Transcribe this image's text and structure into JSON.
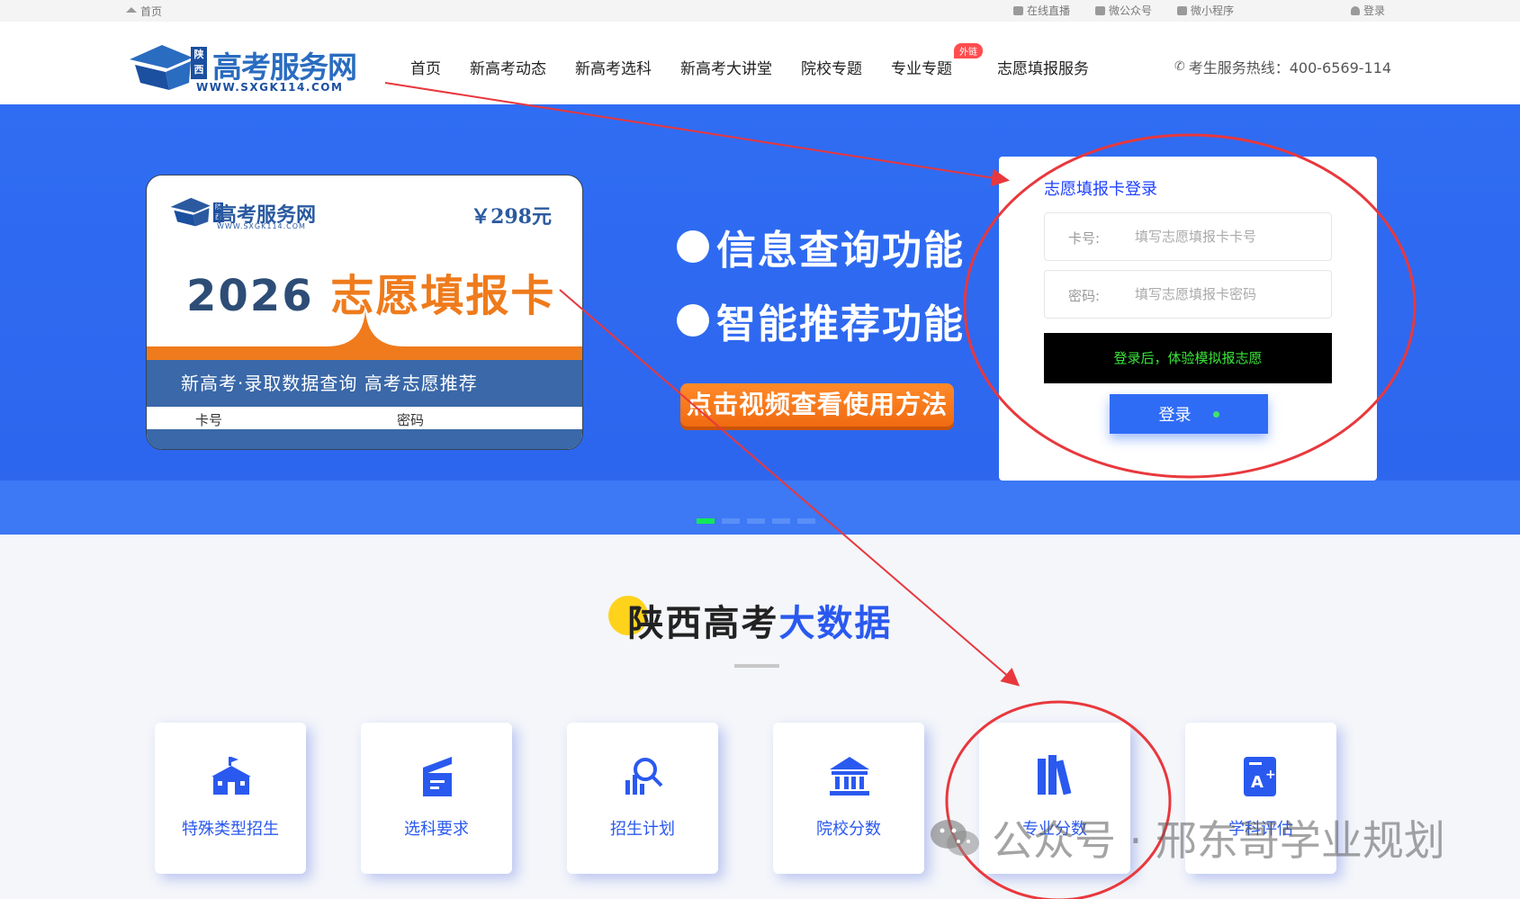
{
  "topbar": {
    "home": "首页",
    "links": [
      "在线直播",
      "微公众号",
      "微小程序"
    ],
    "login": "登录"
  },
  "header": {
    "logo_region": "陕西",
    "logo_title": "高考服务网",
    "logo_url_text": "WWW.SXGK114.COM",
    "nav": [
      "首页",
      "新高考动态",
      "新高考选科",
      "新高考大讲堂",
      "院校专题",
      "专业专题",
      "志愿填报服务"
    ],
    "nav_badge": "外链",
    "hotline": "考生服务热线：400-6569-114"
  },
  "banner": {
    "card": {
      "logo_title": "高考服务网",
      "logo_region": "陕西",
      "logo_url_text": "WWW.SXGK114.COM",
      "price": "￥298元",
      "year": "2026",
      "product": "志愿填报卡",
      "tagline": "新高考·录取数据查询   高考志愿推荐",
      "field_card": "卡号",
      "field_password": "密码"
    },
    "features": [
      "信息查询功能",
      "智能推荐功能"
    ],
    "video_button": "点击视频查看使用方法",
    "slides_total": 5,
    "slide_active": 1
  },
  "login": {
    "title": "志愿填报卡登录",
    "card_label": "卡号:",
    "card_placeholder": "填写志愿填报卡卡号",
    "password_label": "密码:",
    "password_placeholder": "填写志愿填报卡密码",
    "notice": "登录后，体验模拟报志愿",
    "button": "登录"
  },
  "section": {
    "title_prefix": "陕西高考",
    "title_highlight": "大数据",
    "tiles": [
      "特殊类型招生",
      "选科要求",
      "招生计划",
      "院校分数",
      "专业分数",
      "学科评估"
    ]
  },
  "watermark": "公众号 · 邢东哥学业规划",
  "colors": {
    "brand_blue": "#2f6df3",
    "accent_orange": "#ef7b1c",
    "annotation_red": "#e8383d",
    "tile_blue": "#2a59ef"
  }
}
